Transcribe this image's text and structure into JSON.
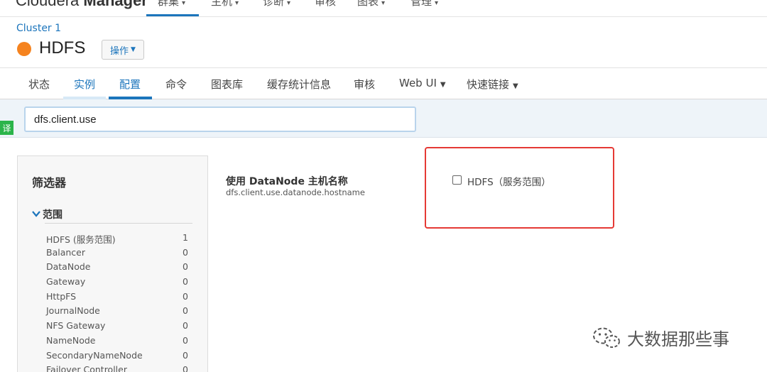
{
  "topnav": {
    "brand_left": "Cloudera ",
    "brand_bold": "Manager",
    "items": [
      {
        "label": "群集"
      },
      {
        "label": "主机"
      },
      {
        "label": "诊断"
      },
      {
        "label": "审核"
      },
      {
        "label": "图表"
      },
      {
        "label": "管理"
      }
    ]
  },
  "header": {
    "breadcrumb": "Cluster 1",
    "service_name": "HDFS",
    "status_color": "#f5831f",
    "actions_label": "操作"
  },
  "tabs": [
    {
      "label": "状态"
    },
    {
      "label": "实例"
    },
    {
      "label": "配置"
    },
    {
      "label": "命令"
    },
    {
      "label": "图表库"
    },
    {
      "label": "缓存统计信息"
    },
    {
      "label": "审核"
    },
    {
      "label": "Web UI"
    },
    {
      "label": "快速链接"
    }
  ],
  "search": {
    "value": "dfs.client.use"
  },
  "translate_badge": "译",
  "filters": {
    "title": "筛选器",
    "scope_label": "范围",
    "items": [
      {
        "name": "HDFS (服务范围)",
        "count": "1"
      },
      {
        "name": "Balancer",
        "count": "0"
      },
      {
        "name": "DataNode",
        "count": "0"
      },
      {
        "name": "Gateway",
        "count": "0"
      },
      {
        "name": "HttpFS",
        "count": "0"
      },
      {
        "name": "JournalNode",
        "count": "0"
      },
      {
        "name": "NFS Gateway",
        "count": "0"
      },
      {
        "name": "NameNode",
        "count": "0"
      },
      {
        "name": "SecondaryNameNode",
        "count": "0"
      },
      {
        "name": "Failover Controller",
        "count": "0"
      }
    ]
  },
  "property": {
    "label": "使用 DataNode 主机名称",
    "key": "dfs.client.use.datanode.hostname",
    "scope_option": "HDFS（服务范围）",
    "checked": false
  },
  "watermark": "大数据那些事",
  "colors": {
    "accent": "#1c75bc",
    "highlight": "#e53935",
    "badge": "#2bb44a"
  }
}
